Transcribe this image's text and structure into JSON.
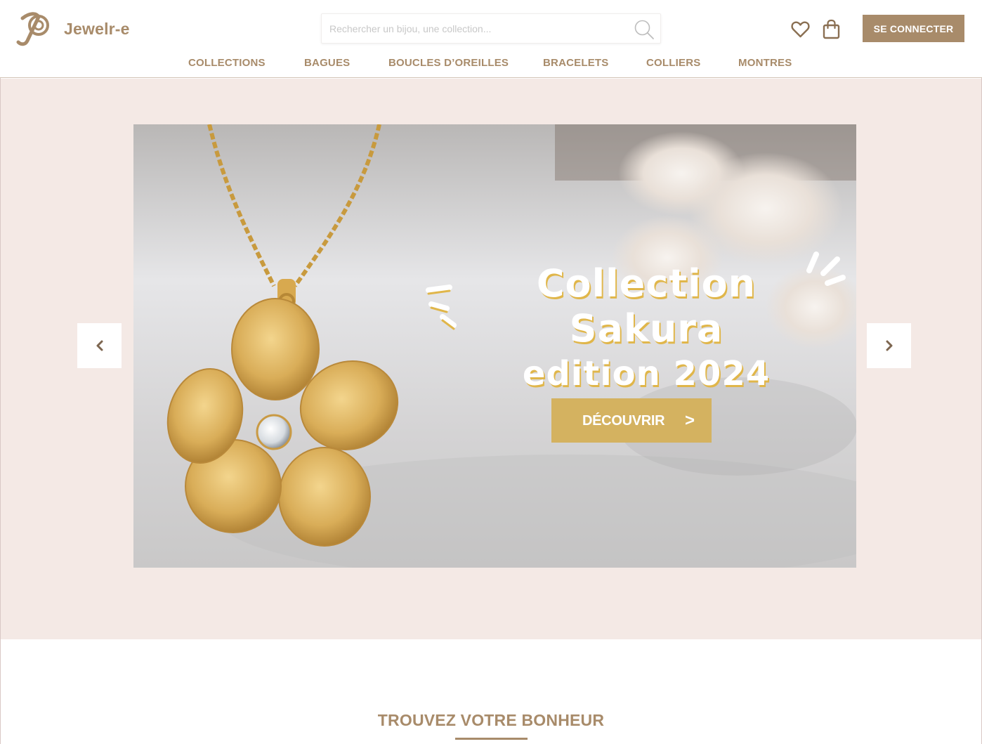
{
  "header": {
    "brand": "Jewelr-e",
    "search_placeholder": "Rechercher un bijou, une collection...",
    "login_label": "SE CONNECTER",
    "icons": [
      "search-icon",
      "heart-icon",
      "shopping-bag-icon"
    ]
  },
  "nav": {
    "items": [
      "COLLECTIONS",
      "BAGUES",
      "BOUCLES D’OREILLES",
      "BRACELETS",
      "COLLIERS",
      "MONTRES"
    ]
  },
  "hero": {
    "title_line1": "Collection Sakura",
    "title_line2": "edition 2024",
    "cta_label": "DÉCOUVRIR",
    "cta_arrow": ">",
    "prev_icon": "chevron-left-icon",
    "next_icon": "chevron-right-icon"
  },
  "section": {
    "title": "TROUVEZ VOTRE BONHEUR"
  },
  "colors": {
    "brand": "#a88b6a",
    "hero_bg": "#f4e9e5",
    "cta": "#d4b260",
    "title_shadow": "#e0b64a"
  }
}
